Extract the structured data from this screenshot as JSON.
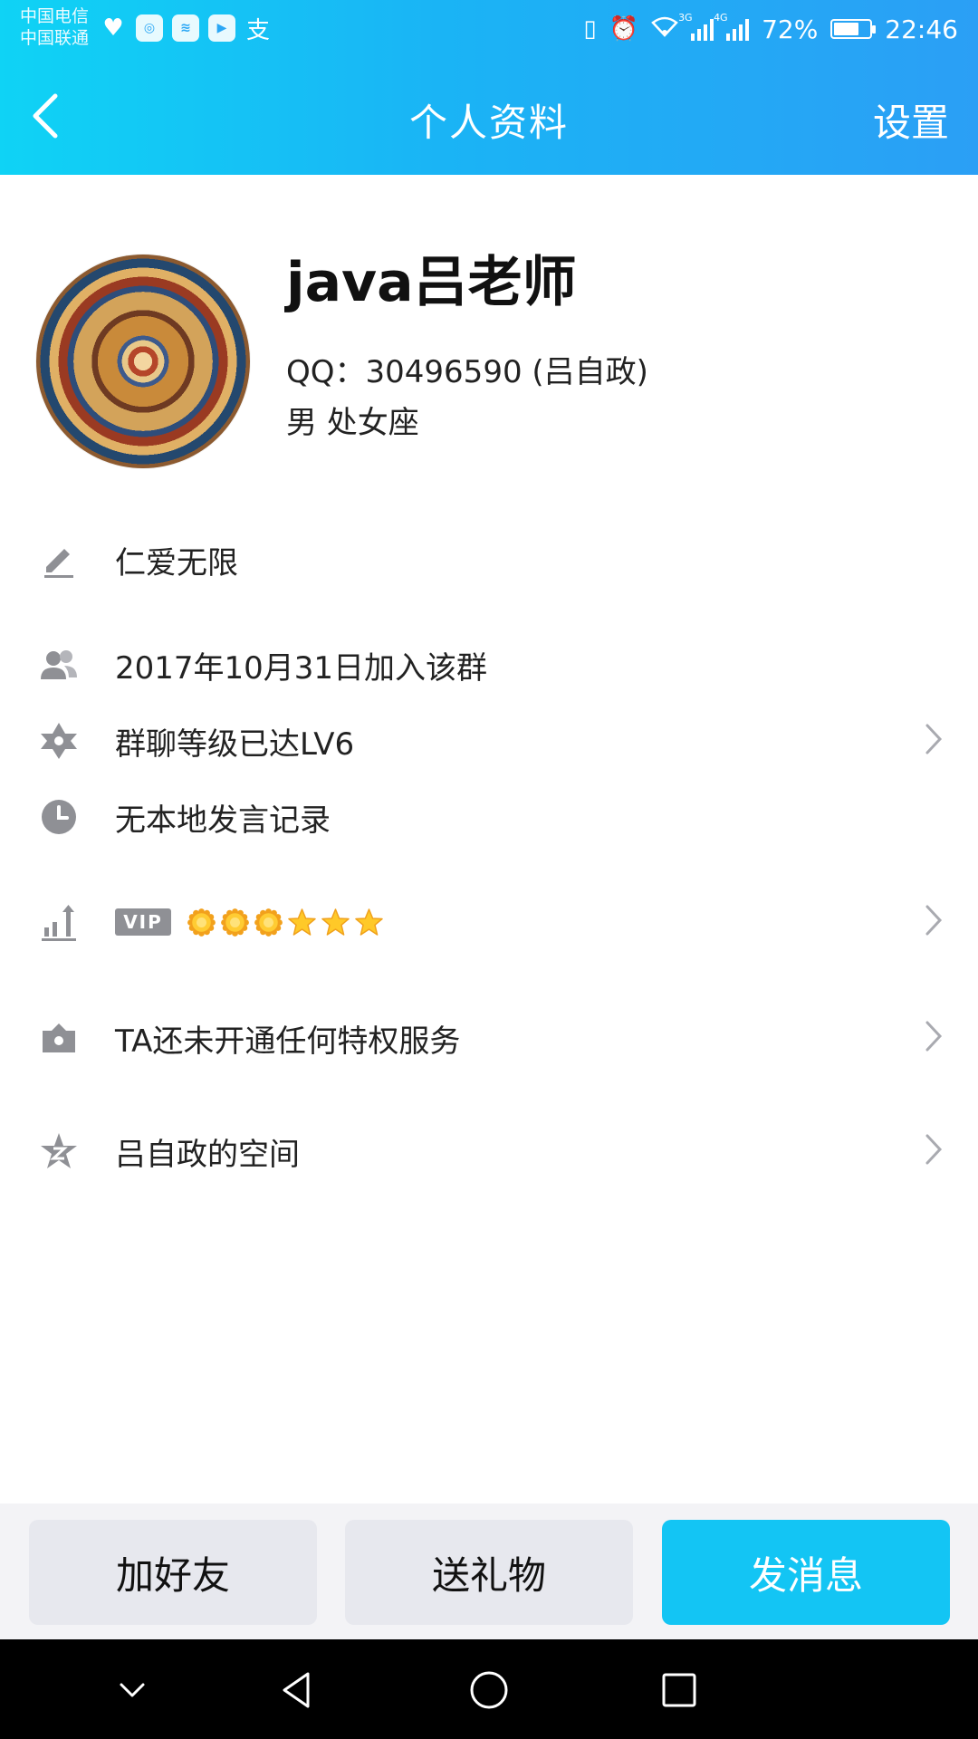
{
  "status_bar": {
    "carrier_1": "中国电信",
    "carrier_2": "中国联通",
    "network_1": "3G",
    "network_2": "4G",
    "battery": "72%",
    "battery_level": 0.72,
    "time": "22:46"
  },
  "navbar": {
    "title": "个人资料",
    "settings_label": "设置"
  },
  "profile": {
    "name": "java吕老师",
    "qq": "QQ：30496590 (吕自政)",
    "gender_sign": "男  处女座"
  },
  "info": {
    "signature": "仁爱无限",
    "joined": "2017年10月31日加入该群",
    "group_level": "群聊等级已达LV6",
    "speech_record": "无本地发言记录",
    "vip_label": "VIP",
    "privilege": "TA还未开通任何特权服务",
    "space": "吕自政的空间"
  },
  "vip_levels": [
    "sun",
    "sun",
    "sun",
    "star",
    "star",
    "star"
  ],
  "actions": {
    "add_friend": "加好友",
    "send_gift": "送礼物",
    "send_message": "发消息"
  },
  "colors": {
    "header_start": "#0fd3f5",
    "header_end": "#2b9ff5",
    "primary_button": "#13c5f4",
    "icon_grey": "#8f9095"
  }
}
